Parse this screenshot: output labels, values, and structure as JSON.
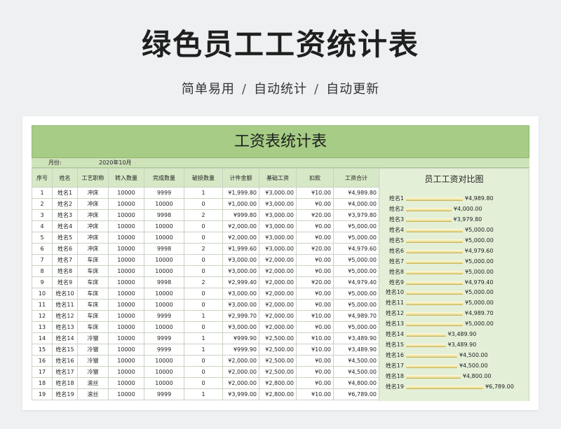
{
  "page": {
    "title": "绿色员工工资统计表",
    "subtitle_parts": [
      "简单易用",
      "自动统计",
      "自动更新"
    ],
    "separator": "/"
  },
  "sheet": {
    "title": "工资表统计表",
    "month_label": "月份:",
    "month_value": "2020年10月",
    "columns": [
      "序号",
      "姓名",
      "工艺职称",
      "转入数量",
      "完成数量",
      "破损数量",
      "计件金额",
      "基础工资",
      "扣款",
      "工资合计"
    ],
    "rows": [
      [
        "1",
        "姓名1",
        "冲床",
        "10000",
        "9999",
        "1",
        "¥1,999.80",
        "¥3,000.00",
        "¥10.00",
        "¥4,989.80"
      ],
      [
        "2",
        "姓名2",
        "冲床",
        "10000",
        "10000",
        "0",
        "¥1,000.00",
        "¥3,000.00",
        "¥0.00",
        "¥4,000.00"
      ],
      [
        "3",
        "姓名3",
        "冲床",
        "10000",
        "9998",
        "2",
        "¥999.80",
        "¥3,000.00",
        "¥20.00",
        "¥3,979.80"
      ],
      [
        "4",
        "姓名4",
        "冲床",
        "10000",
        "10000",
        "0",
        "¥2,000.00",
        "¥3,000.00",
        "¥0.00",
        "¥5,000.00"
      ],
      [
        "5",
        "姓名5",
        "冲床",
        "10000",
        "10000",
        "0",
        "¥2,000.00",
        "¥3,000.00",
        "¥0.00",
        "¥5,000.00"
      ],
      [
        "6",
        "姓名6",
        "冲床",
        "10000",
        "9998",
        "2",
        "¥1,999.60",
        "¥3,000.00",
        "¥20.00",
        "¥4,979.60"
      ],
      [
        "7",
        "姓名7",
        "车床",
        "10000",
        "10000",
        "0",
        "¥3,000.00",
        "¥2,000.00",
        "¥0.00",
        "¥5,000.00"
      ],
      [
        "8",
        "姓名8",
        "车床",
        "10000",
        "10000",
        "0",
        "¥3,000.00",
        "¥2,000.00",
        "¥0.00",
        "¥5,000.00"
      ],
      [
        "9",
        "姓名9",
        "车床",
        "10000",
        "9998",
        "2",
        "¥2,999.40",
        "¥2,000.00",
        "¥20.00",
        "¥4,979.40"
      ],
      [
        "10",
        "姓名10",
        "车床",
        "10000",
        "10000",
        "0",
        "¥3,000.00",
        "¥2,000.00",
        "¥0.00",
        "¥5,000.00"
      ],
      [
        "11",
        "姓名11",
        "车床",
        "10000",
        "10000",
        "0",
        "¥3,000.00",
        "¥2,000.00",
        "¥0.00",
        "¥5,000.00"
      ],
      [
        "12",
        "姓名12",
        "车床",
        "10000",
        "9999",
        "1",
        "¥2,999.70",
        "¥2,000.00",
        "¥10.00",
        "¥4,989.70"
      ],
      [
        "13",
        "姓名13",
        "车床",
        "10000",
        "10000",
        "0",
        "¥3,000.00",
        "¥2,000.00",
        "¥0.00",
        "¥5,000.00"
      ],
      [
        "14",
        "姓名14",
        "冷镦",
        "10000",
        "9999",
        "1",
        "¥999.90",
        "¥2,500.00",
        "¥10.00",
        "¥3,489.90"
      ],
      [
        "15",
        "姓名15",
        "冷镦",
        "10000",
        "9999",
        "1",
        "¥999.90",
        "¥2,500.00",
        "¥10.00",
        "¥3,489.90"
      ],
      [
        "16",
        "姓名16",
        "冷镦",
        "10000",
        "10000",
        "0",
        "¥2,000.00",
        "¥2,500.00",
        "¥0.00",
        "¥4,500.00"
      ],
      [
        "17",
        "姓名17",
        "冷镦",
        "10000",
        "10000",
        "0",
        "¥2,000.00",
        "¥2,500.00",
        "¥0.00",
        "¥4,500.00"
      ],
      [
        "18",
        "姓名18",
        "滚丝",
        "10000",
        "10000",
        "0",
        "¥2,000.00",
        "¥2,800.00",
        "¥0.00",
        "¥4,800.00"
      ],
      [
        "19",
        "姓名19",
        "滚丝",
        "10000",
        "9999",
        "1",
        "¥3,999.00",
        "¥2,800.00",
        "¥10.00",
        "¥6,789.00"
      ]
    ]
  },
  "chart_data": {
    "type": "bar",
    "title": "员工工资对比图",
    "categories": [
      "姓名1",
      "姓名2",
      "姓名3",
      "姓名4",
      "姓名5",
      "姓名6",
      "姓名7",
      "姓名8",
      "姓名9",
      "姓名10",
      "姓名11",
      "姓名12",
      "姓名13",
      "姓名14",
      "姓名15",
      "姓名16",
      "姓名17",
      "姓名18",
      "姓名19"
    ],
    "values": [
      4989.8,
      4000.0,
      3979.8,
      5000.0,
      5000.0,
      4979.6,
      5000.0,
      5000.0,
      4979.4,
      5000.0,
      5000.0,
      4989.7,
      5000.0,
      3489.9,
      3489.9,
      4500.0,
      4500.0,
      4800.0,
      6789.0
    ],
    "value_labels": [
      "¥4,989.80",
      "¥4,000.00",
      "¥3,979.80",
      "¥5,000.00",
      "¥5,000.00",
      "¥4,979.60",
      "¥5,000.00",
      "¥5,000.00",
      "¥4,979.40",
      "¥5,000.00",
      "¥5,000.00",
      "¥4,989.70",
      "¥5,000.00",
      "¥3,489.90",
      "¥3,489.90",
      "¥4,500.00",
      "¥4,500.00",
      "¥4,800.00",
      "¥6,789.00"
    ],
    "orientation": "horizontal",
    "xlim": [
      0,
      7000
    ],
    "grid": false,
    "colors": {
      "bar_top": "#fffbe0",
      "bar_bottom": "#e8d98a",
      "bar_edge": "#c7b35a"
    }
  },
  "colors": {
    "title_band": "#a6cc85",
    "month_band": "#cfe3bb",
    "header_cell": "#d7e8c6",
    "chart_bg": "#e4efd8",
    "page_bg": "#eef0f2"
  }
}
